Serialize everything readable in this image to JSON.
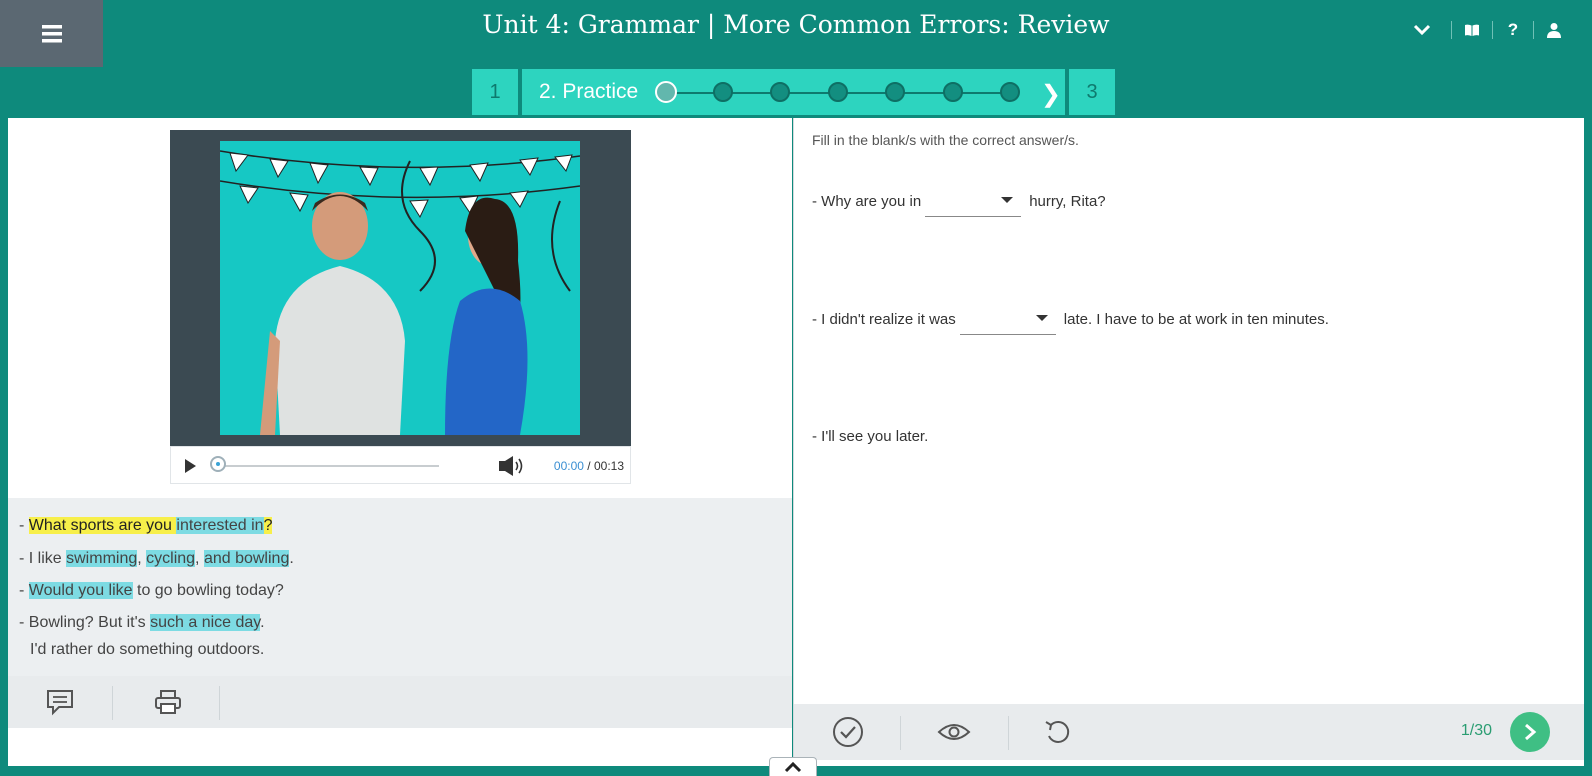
{
  "header": {
    "title": "Unit 4: Grammar | More Common Errors: Review",
    "icons": [
      "menu-icon",
      "chevron-down-icon",
      "book-icon",
      "help-icon",
      "user-icon"
    ],
    "help_glyph": "?"
  },
  "steps": {
    "step1": "1",
    "step2": "2. Practice",
    "step3": "3",
    "dot_count": 7,
    "active_dot": 1
  },
  "video": {
    "time_current": "00:00",
    "time_total": "/ 00:13",
    "progress": 0
  },
  "transcript": {
    "l1": {
      "dash": "- ",
      "a": "What sports are you ",
      "b": "interested in",
      "c": "?"
    },
    "l2": {
      "pre": "- I like ",
      "a": "swimming",
      "s1": ", ",
      "b": "cycling",
      "s2": ", ",
      "c": "and bowling",
      "end": "."
    },
    "l3": {
      "dash": "- ",
      "a": "Would you like",
      "rest": " to go bowling today?"
    },
    "l4": {
      "pre": "- Bowling? But it's ",
      "a": "such a nice day",
      "end": "."
    },
    "l5": "I'd rather do something outdoors."
  },
  "exercise": {
    "instruction": "Fill in the blank/s with the correct answer/s.",
    "q1": {
      "before": "- Why are you in",
      "after": "hurry, Rita?"
    },
    "q2": {
      "before": "- I didn't realize it was",
      "after": "late. I have to be at work in ten minutes."
    },
    "q3": "- I'll see you later."
  },
  "footer": {
    "page_count": "1/30"
  },
  "colors": {
    "teal": "#0e8a7c",
    "step_bg": "#2dd4bf",
    "highlight_yellow": "#f7ef4a",
    "highlight_blue": "#7ddbe3",
    "next_green": "#3fbf84"
  }
}
